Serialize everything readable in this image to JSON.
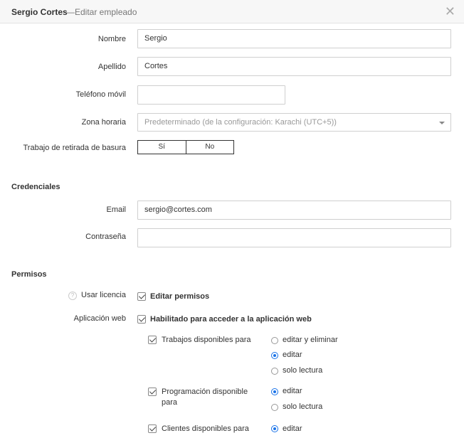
{
  "header": {
    "name": "Sergio Cortes",
    "subtitle": "—Editar empleado"
  },
  "form": {
    "first_name": {
      "label": "Nombre",
      "value": "Sergio"
    },
    "last_name": {
      "label": "Apellido",
      "value": "Cortes"
    },
    "mobile": {
      "label": "Teléfono móvil",
      "value": ""
    },
    "timezone": {
      "label": "Zona horaria",
      "value": "Predeterminado (de la configuración: Karachi (UTC+5))"
    },
    "waste_job": {
      "label": "Trabajo de retirada de basura",
      "yes": "Sí",
      "no": "No"
    }
  },
  "credentials": {
    "title": "Credenciales",
    "email": {
      "label": "Email",
      "value": "sergio@cortes.com"
    },
    "password": {
      "label": "Contraseña",
      "value": ""
    }
  },
  "permissions": {
    "title": "Permisos",
    "use_license": {
      "label": "Usar licencia",
      "option": "Editar permisos",
      "checked": true
    },
    "web_app": {
      "label": "Aplicación web",
      "option": "Habilitado para acceder a la aplicación web",
      "checked": true
    },
    "jobs": {
      "label": "Trabajos disponibles para",
      "checked": true,
      "options": [
        "editar y eliminar",
        "editar",
        "solo lectura"
      ],
      "selected": "editar"
    },
    "scheduling": {
      "label": "Programación disponible para",
      "checked": true,
      "options": [
        "editar",
        "solo lectura"
      ],
      "selected": "editar"
    },
    "clients": {
      "label": "Clientes disponibles para",
      "checked": true,
      "options": [
        "editar"
      ],
      "selected": "editar"
    }
  }
}
